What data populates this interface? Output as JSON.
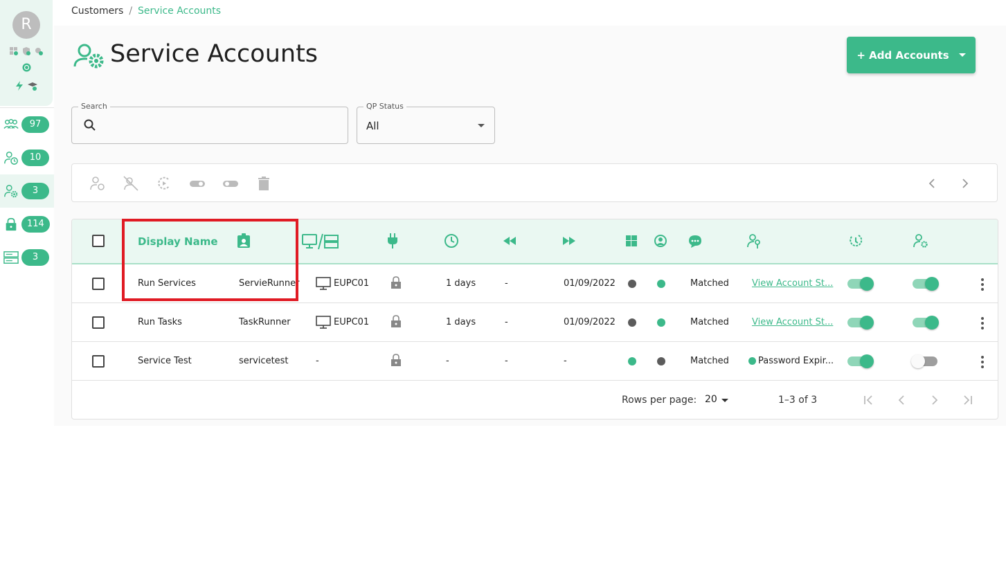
{
  "profile": {
    "avatar_letter": "R"
  },
  "sidebar": {
    "items": [
      {
        "icon": "users-group-icon",
        "count": "97"
      },
      {
        "icon": "user-clock-icon",
        "count": "10"
      },
      {
        "icon": "user-gear-icon",
        "count": "3",
        "active": true
      },
      {
        "icon": "lock-icon",
        "count": "114"
      },
      {
        "icon": "server-icon",
        "count": "3"
      }
    ]
  },
  "breadcrumb": {
    "parent": "Customers",
    "separator": "/",
    "current": "Service Accounts"
  },
  "page": {
    "title": "Service Accounts",
    "add_button": "+ Add Accounts"
  },
  "filters": {
    "search_label": "Search",
    "search_value": "",
    "search_placeholder": "",
    "qp_status_label": "QP Status",
    "qp_status_value": "All"
  },
  "table": {
    "header": {
      "display_name": "Display Name"
    },
    "rows": [
      {
        "display_name": "Run Services",
        "account": "ServieRunner",
        "machine": "EUPC01",
        "age": "1 days",
        "prev": "-",
        "next": "01/09/2022",
        "win_dot": "dark",
        "user_dot": "green",
        "status": "Matched",
        "link": "View Account St...",
        "link_is_link": true,
        "toggle1": "on",
        "toggle2": "on"
      },
      {
        "display_name": "Run Tasks",
        "account": "TaskRunner",
        "machine": "EUPC01",
        "age": "1 days",
        "prev": "-",
        "next": "01/09/2022",
        "win_dot": "dark",
        "user_dot": "green",
        "status": "Matched",
        "link": "View Account St...",
        "link_is_link": true,
        "toggle1": "on",
        "toggle2": "on"
      },
      {
        "display_name": "Service Test",
        "account": "servicetest",
        "machine": "-",
        "age": "-",
        "prev": "-",
        "next": "-",
        "win_dot": "green",
        "user_dot": "dark",
        "status": "Matched",
        "link": "Password Expir...",
        "link_is_link": false,
        "toggle1": "on",
        "toggle2": "off"
      }
    ]
  },
  "pagination": {
    "rows_per_page_label": "Rows per page:",
    "rows_per_page_value": "20",
    "range": "1–3 of 3"
  },
  "colors": {
    "accent": "#3cb98a",
    "header_bg": "#eaf8f2",
    "highlight": "#e01b24"
  }
}
